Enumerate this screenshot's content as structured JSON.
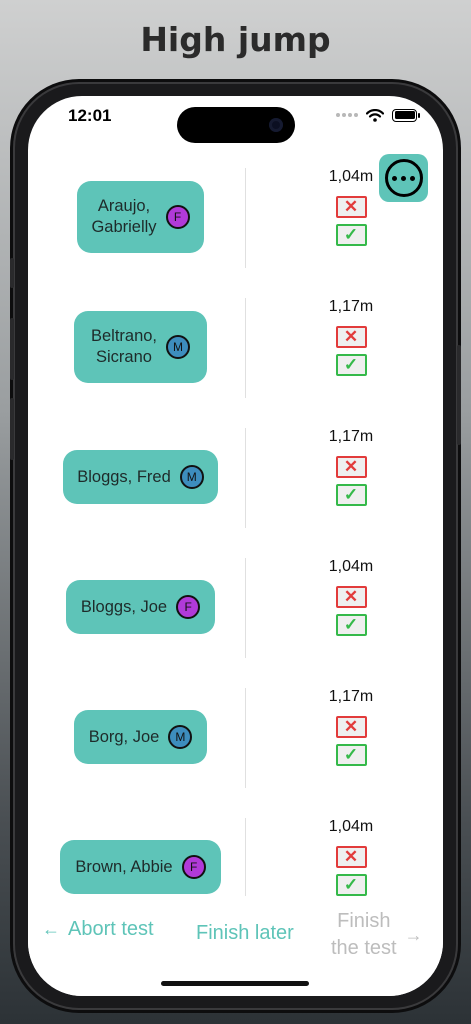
{
  "page": {
    "title": "High jump"
  },
  "status_bar": {
    "time": "12:01"
  },
  "athletes": [
    {
      "name": "Araujo,\nGabrielly",
      "gender": "F",
      "height": "1,04m"
    },
    {
      "name": "Beltrano,\nSicrano",
      "gender": "M",
      "height": "1,17m"
    },
    {
      "name": "Bloggs, Fred",
      "gender": "M",
      "height": "1,17m"
    },
    {
      "name": "Bloggs, Joe",
      "gender": "F",
      "height": "1,04m"
    },
    {
      "name": "Borg, Joe",
      "gender": "M",
      "height": "1,17m"
    },
    {
      "name": "Brown, Abbie",
      "gender": "F",
      "height": "1,04m"
    }
  ],
  "marks": {
    "fail": "✕",
    "success": "✓"
  },
  "bottom_bar": {
    "abort_label": "Abort test",
    "later_label": "Finish later",
    "finish_label": "Finish\nthe test"
  },
  "icons": {
    "back_arrow": "←",
    "forward_arrow": "→",
    "more": "more-options-icon"
  },
  "colors": {
    "accent": "#5ec4b8",
    "female": "#b03ad8",
    "male": "#3d8dbd",
    "fail": "#e23b3b",
    "success": "#35b94a",
    "disabled": "#bdbdbd"
  }
}
